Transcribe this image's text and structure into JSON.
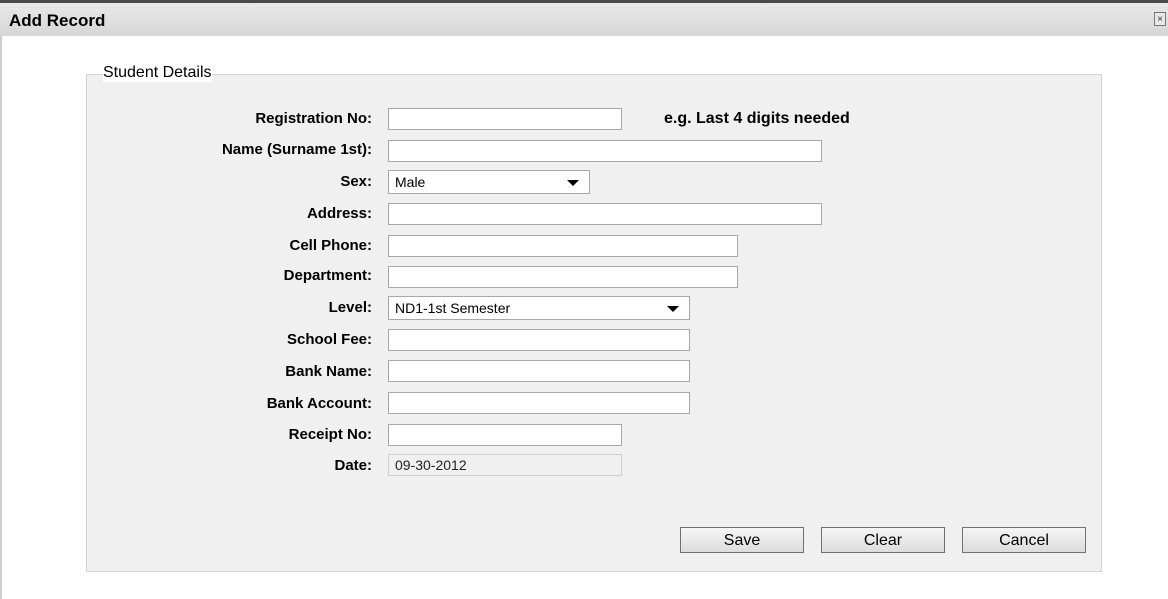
{
  "window": {
    "title": "Add Record",
    "close_icon": "close-icon"
  },
  "group": {
    "title": "Student Details"
  },
  "fields": {
    "registration": {
      "label": "Registration No:",
      "value": "",
      "hint": "e.g. Last 4 digits needed"
    },
    "name": {
      "label": "Name (Surname 1st):",
      "value": ""
    },
    "sex": {
      "label": "Sex:",
      "value": "Male"
    },
    "address": {
      "label": "Address:",
      "value": ""
    },
    "cell_phone": {
      "label": "Cell Phone:",
      "value": ""
    },
    "department": {
      "label": "Department:",
      "value": ""
    },
    "level": {
      "label": "Level:",
      "value": "ND1-1st Semester"
    },
    "school_fee": {
      "label": "School Fee:",
      "value": ""
    },
    "bank_name": {
      "label": "Bank Name:",
      "value": ""
    },
    "bank_account": {
      "label": "Bank Account:",
      "value": ""
    },
    "receipt_no": {
      "label": "Receipt No:",
      "value": ""
    },
    "date": {
      "label": "Date:",
      "value": "09-30-2012"
    }
  },
  "buttons": {
    "save": "Save",
    "clear": "Clear",
    "cancel": "Cancel"
  }
}
